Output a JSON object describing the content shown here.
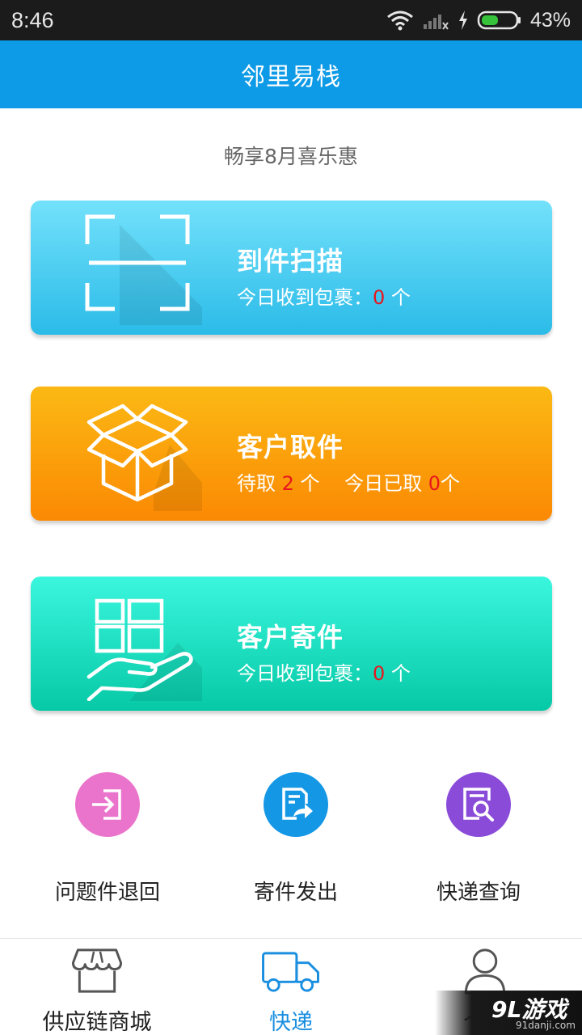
{
  "status_bar": {
    "time": "8:46",
    "battery_percent": "43%"
  },
  "header": {
    "title": "邻里易栈"
  },
  "promo_text": "畅享8月喜乐惠",
  "cards": {
    "scan": {
      "title": "到件扫描",
      "prefix": "今日收到包裹：",
      "count": "0",
      "suffix": " 个",
      "icon": "scan-frame-icon",
      "color_top": "#73e1fb",
      "color_bottom": "#2bbbe8"
    },
    "pickup": {
      "title": "客户取件",
      "pending_prefix": "待取 ",
      "pending_count": "2",
      "pending_suffix": " 个    ",
      "today_prefix": "今日已取 ",
      "today_count": "0",
      "today_suffix": "个",
      "icon": "open-box-icon",
      "color_top": "#fbb914",
      "color_bottom": "#fb8903"
    },
    "send": {
      "title": "客户寄件",
      "prefix": "今日收到包裹：",
      "count": "0",
      "suffix": " 个",
      "icon": "parcel-hand-icon",
      "color_top": "#3af6de",
      "color_bottom": "#06c9a6"
    }
  },
  "quick_actions": [
    {
      "label": "问题件退回",
      "icon": "return-icon",
      "color": "#ea74cb"
    },
    {
      "label": "寄件发出",
      "icon": "send-out-icon",
      "color": "#1497e5"
    },
    {
      "label": "快递查询",
      "icon": "search-doc-icon",
      "color": "#8a4bd9"
    }
  ],
  "bottom_nav": [
    {
      "label": "供应链商城",
      "icon": "store-icon",
      "active": false
    },
    {
      "label": "快递",
      "icon": "truck-icon",
      "active": true
    },
    {
      "label": "个人",
      "icon": "person-icon",
      "active": false
    }
  ],
  "watermark": {
    "logo": "9L游戏",
    "site": "91danji.com"
  }
}
